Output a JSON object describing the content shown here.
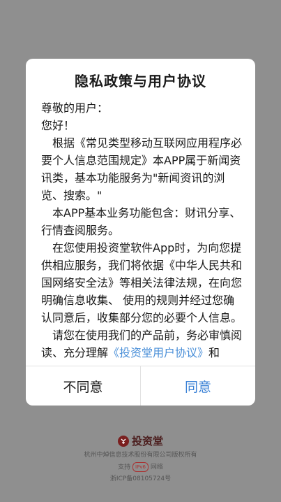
{
  "dialog": {
    "title": "隐私政策与用户协议",
    "greeting": "尊敬的用户：",
    "hello": "您好！",
    "para1": "根据《常见类型移动互联网应用程序必要个人信息范围规定》本APP属于新闻资讯类，基本功能服务为\"新闻资讯的浏览、搜索。\"",
    "para2": "本APP基本业务功能包含：财讯分享、行情查阅服务。",
    "para3": "在您使用投资堂软件App时，为向您提供相应服务，我们将依据《中华人民共和国网络安全法》等相关法律法规，在向您明确信息收集、 使用的规则并经过您确认同意后，收集部分您的必要个人信息。",
    "para4_prefix": "请您在使用我们的产品前，务必审慎阅读、充分理解",
    "para4_link": "《投资堂用户协议》",
    "para4_suffix": "和",
    "disagree_label": "不同意",
    "agree_label": "同意"
  },
  "footer": {
    "brand": "投资堂",
    "copyright": "杭州中焯信息技术股份有限公司版权所有",
    "support_prefix": "支持",
    "ipv6_badge": "IPv6",
    "support_suffix": "网络",
    "icp": "浙ICP备08105724号"
  },
  "colors": {
    "accent": "#3b82d6",
    "link": "#4a8fd8",
    "overlay": "#8f8f8f",
    "brand": "#7a1f1f"
  }
}
